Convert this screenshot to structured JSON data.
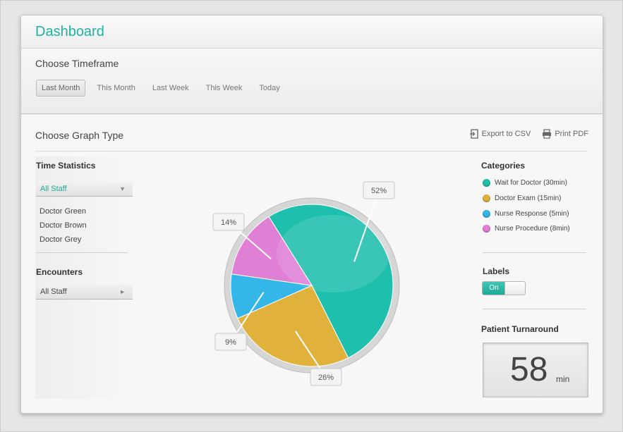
{
  "header": {
    "title": "Dashboard"
  },
  "timeframe": {
    "title": "Choose Timeframe",
    "tabs": [
      "Last Month",
      "This Month",
      "Last Week",
      "This Week",
      "Today"
    ],
    "selected": "Last Month"
  },
  "graph": {
    "title": "Choose Graph Type",
    "actions": {
      "export_csv": "Export to CSV",
      "print_pdf": "Print PDF"
    }
  },
  "left": {
    "time_statistics_label": "Time Statistics",
    "time_statistics_select": "All Staff",
    "staff": [
      "Doctor Green",
      "Doctor Brown",
      "Doctor Grey"
    ],
    "encounters_label": "Encounters",
    "encounters_select": "All Staff"
  },
  "right": {
    "categories_label": "Categories",
    "categories": [
      {
        "label": "Wait for Doctor (30min)",
        "color": "#1fbfae"
      },
      {
        "label": "Doctor Exam (15min)",
        "color": "#e0b23c"
      },
      {
        "label": "Nurse Response (5min)",
        "color": "#35b6e8"
      },
      {
        "label": "Nurse Procedure (8min)",
        "color": "#e07fd6"
      }
    ],
    "labels_label": "Labels",
    "labels_toggle": "On",
    "turnaround_label": "Patient Turnaround",
    "turnaround_value": "58",
    "turnaround_unit": "min"
  },
  "chart_data": {
    "type": "pie",
    "title": "",
    "categories": [
      "Wait for Doctor (30min)",
      "Doctor Exam (15min)",
      "Nurse Response (5min)",
      "Nurse Procedure (8min)"
    ],
    "values": [
      52,
      26,
      9,
      14
    ],
    "labels": [
      "52%",
      "26%",
      "9%",
      "14%"
    ],
    "colors": [
      "#1fbfae",
      "#e0b23c",
      "#35b6e8",
      "#e07fd6"
    ]
  }
}
